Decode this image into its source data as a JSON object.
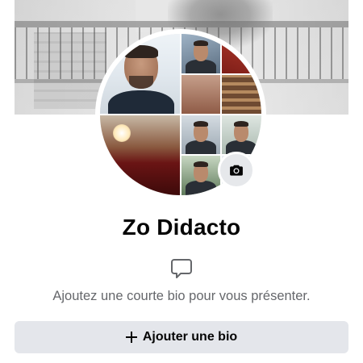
{
  "profile": {
    "name": "Zo Didacto",
    "cover_photo_icon": "cover-photo",
    "avatar_icon": "profile-picture-collage",
    "camera_icon": "camera-icon"
  },
  "bio": {
    "icon": "speech-bubble-icon",
    "hint": "Ajoutez une courte bio pour vous présenter.",
    "button_label": "Ajouter une bio",
    "button_icon": "plus-icon"
  },
  "colors": {
    "primary_text": "#050505",
    "secondary_text": "#65676b",
    "button_bg": "#e4e6eb",
    "background": "#ffffff"
  }
}
